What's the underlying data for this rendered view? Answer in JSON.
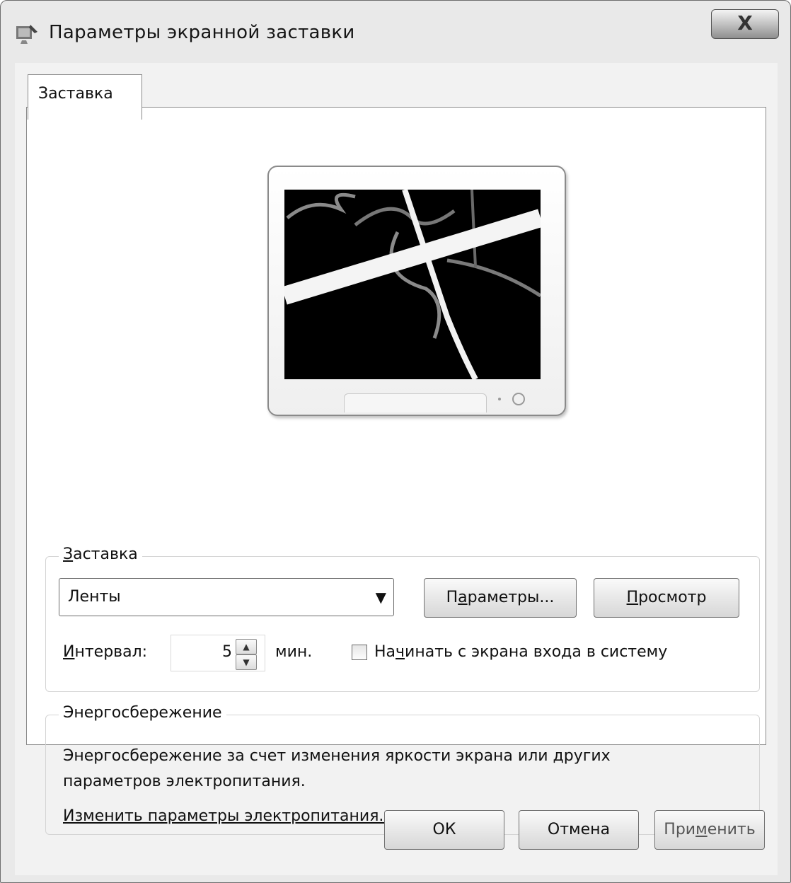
{
  "window": {
    "title": "Параметры экранной заставки",
    "close_label": "X",
    "app_icon": "screensaver-settings-icon"
  },
  "tabs": [
    {
      "label": "Заставка",
      "selected": true
    }
  ],
  "screensaver": {
    "group_label_key": "З",
    "group_label_rest": "аставка",
    "selected": "Ленты",
    "dropdown_icon": "dropdown-arrow-icon",
    "params_button": {
      "pre": "П",
      "key": "а",
      "post": "раметры..."
    },
    "preview_button": {
      "key": "П",
      "post": "росмотр"
    },
    "interval_label_key": "И",
    "interval_label_rest": "нтервал:",
    "interval_value": "5",
    "interval_unit": "мин.",
    "logon_checkbox": {
      "pre": "На",
      "key": "ч",
      "post": "инать с экрана входа в систему",
      "checked": false
    }
  },
  "power": {
    "group_label": "Энергосбережение",
    "description": "Энергосбережение за счет изменения яркости экрана или других параметров электропитания.",
    "link": "Изменить параметры электропитания..."
  },
  "footer": {
    "ok": "ОК",
    "cancel": "Отмена",
    "apply": {
      "pre": "При",
      "key": "м",
      "post": "енить"
    }
  }
}
